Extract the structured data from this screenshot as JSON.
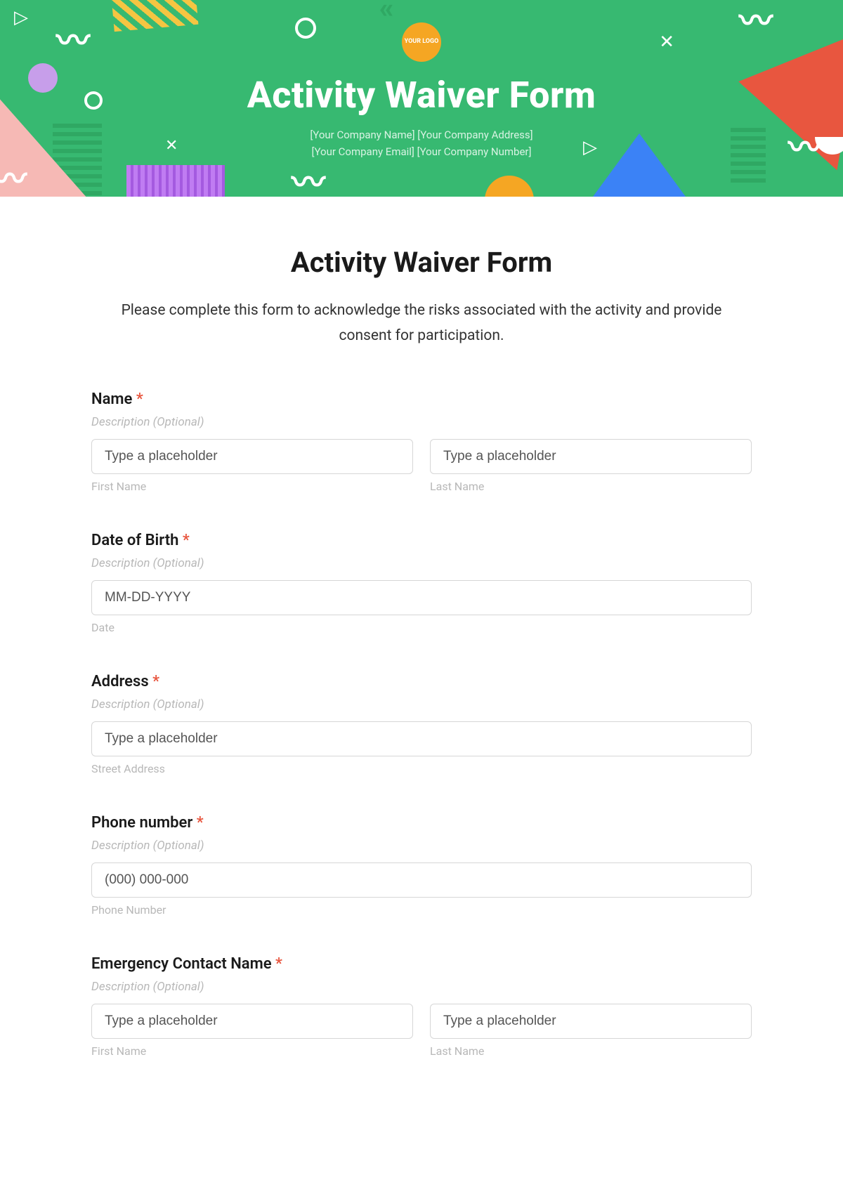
{
  "banner": {
    "logo_text": "YOUR LOGO",
    "title": "Activity Waiver Form",
    "company_line1": "[Your Company Name] [Your Company Address]",
    "company_line2": "[Your Company Email] [Your Company Number]"
  },
  "form": {
    "title": "Activity Waiver Form",
    "description": "Please complete this form to acknowledge the risks associated with the activity and provide consent for participation.",
    "required_marker": "*",
    "fields": {
      "name": {
        "label": "Name",
        "hint": "Description (Optional)",
        "first_placeholder": "Type a placeholder",
        "first_sublabel": "First Name",
        "last_placeholder": "Type a placeholder",
        "last_sublabel": "Last Name"
      },
      "dob": {
        "label": "Date of Birth",
        "hint": "Description (Optional)",
        "placeholder": "MM-DD-YYYY",
        "sublabel": "Date"
      },
      "address": {
        "label": "Address",
        "hint": "Description (Optional)",
        "placeholder": "Type a placeholder",
        "sublabel": "Street Address"
      },
      "phone": {
        "label": "Phone number",
        "hint": "Description (Optional)",
        "placeholder": "(000) 000-000",
        "sublabel": "Phone Number"
      },
      "emergency": {
        "label": "Emergency Contact Name",
        "hint": "Description (Optional)",
        "first_placeholder": "Type a placeholder",
        "first_sublabel": "First Name",
        "last_placeholder": "Type a placeholder",
        "last_sublabel": "Last Name"
      }
    }
  }
}
